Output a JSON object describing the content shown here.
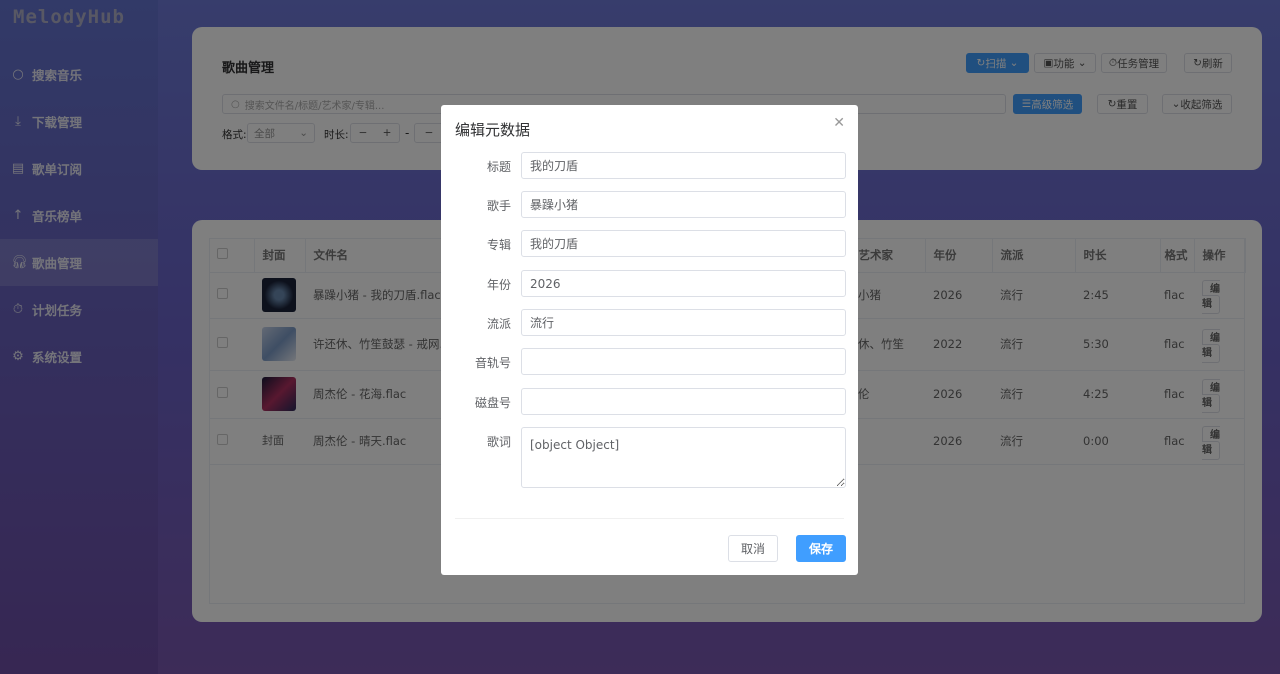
{
  "app": {
    "logo": "MelodyHub"
  },
  "sidebar": {
    "items": [
      {
        "label": "搜索音乐",
        "icon": "search-icon"
      },
      {
        "label": "下载管理",
        "icon": "download-icon"
      },
      {
        "label": "歌单订阅",
        "icon": "clipboard-icon"
      },
      {
        "label": "音乐榜单",
        "icon": "arrow-up-icon"
      },
      {
        "label": "歌曲管理",
        "icon": "headphones-icon",
        "active": true
      },
      {
        "label": "计划任务",
        "icon": "timer-icon"
      },
      {
        "label": "系统设置",
        "icon": "gear-icon"
      }
    ]
  },
  "header": {
    "title": "歌曲管理",
    "scan": "扫描",
    "functions": "功能",
    "tasks": "任务管理",
    "refresh": "刷新"
  },
  "filters": {
    "search_placeholder": "搜索文件名/标题/艺术家/专辑...",
    "advanced": "高级筛选",
    "reset": "重置",
    "collapse": "收起筛选",
    "format_label": "格式:",
    "format_value": "全部",
    "duration_label": "时长:",
    "minus": "−",
    "plus": "+",
    "dash": "-"
  },
  "table": {
    "headers": [
      "封面",
      "文件名",
      "艺术家",
      "年份",
      "流派",
      "时长",
      "格式",
      "操作"
    ],
    "rows": [
      {
        "filename": "暴躁小猪 - 我的刀盾.flac",
        "artist": "小猪",
        "year": "2026",
        "genre": "流行",
        "duration": "2:45",
        "format": "flac",
        "action": "编辑"
      },
      {
        "filename": "许还休、竹笙鼓瑟 - 戒网.flac",
        "artist": "休、竹笙",
        "year": "2022",
        "genre": "流行",
        "duration": "5:30",
        "format": "flac",
        "action": "编辑"
      },
      {
        "filename": "周杰伦 - 花海.flac",
        "artist": "伦",
        "year": "2026",
        "genre": "流行",
        "duration": "4:25",
        "format": "flac",
        "action": "编辑"
      },
      {
        "filename": "周杰伦 - 晴天.flac",
        "artist": "",
        "year": "2026",
        "genre": "流行",
        "duration": "0:00",
        "format": "flac",
        "action": "编辑",
        "cover_alt": "封面"
      }
    ]
  },
  "modal": {
    "title": "编辑元数据",
    "fields": [
      {
        "label": "标题",
        "value": "我的刀盾"
      },
      {
        "label": "歌手",
        "value": "暴躁小猪"
      },
      {
        "label": "专辑",
        "value": "我的刀盾"
      },
      {
        "label": "年份",
        "value": "2026"
      },
      {
        "label": "流派",
        "value": "流行"
      },
      {
        "label": "音轨号",
        "value": ""
      },
      {
        "label": "磁盘号",
        "value": ""
      }
    ],
    "lyrics_label": "歌词",
    "lyrics_value": "[object Object]",
    "cancel": "取消",
    "save": "保存"
  },
  "colors": {
    "primary": "#409eff"
  }
}
